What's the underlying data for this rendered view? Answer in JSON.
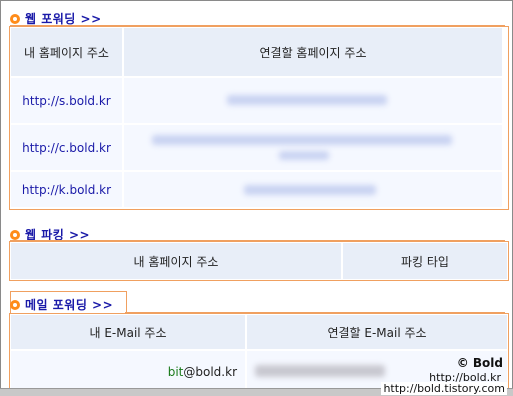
{
  "web_forwarding": {
    "title": "웹 포워딩 >>",
    "headers": [
      "내 홈페이지 주소",
      "연결할 홈페이지 주소"
    ],
    "rows": [
      {
        "my_address": "http://s.bold.kr"
      },
      {
        "my_address": "http://c.bold.kr"
      },
      {
        "my_address": "http://k.bold.kr"
      }
    ]
  },
  "web_parking": {
    "title": "웹 파킹 >>",
    "headers": [
      "내 홈페이지 주소",
      "파킹 타입"
    ]
  },
  "mail_forwarding": {
    "title": "메일 포워딩 >>",
    "headers": [
      "내 E-Mail 주소",
      "연결할 E-Mail 주소"
    ],
    "rows": [
      {
        "email_user": "bit",
        "email_domain": "@bold.kr"
      }
    ]
  },
  "watermark": {
    "copyright": "Bold",
    "symbol": "©",
    "url": "http://bold.tistory.com",
    "domain": "http://bold.kr"
  },
  "colors": {
    "accent_orange": "#f0a060",
    "link_blue": "#1a1aa8",
    "header_bg": "#e8eef8"
  }
}
